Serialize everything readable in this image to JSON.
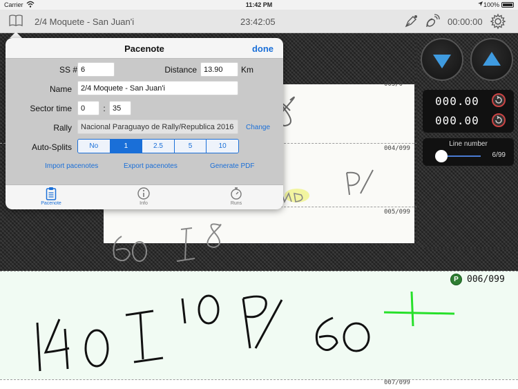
{
  "status_bar": {
    "carrier": "Carrier",
    "time": "11:42 PM",
    "battery": "100%"
  },
  "nav_bar": {
    "title": "2/4 Moquete - San Juan'i",
    "clock": "23:42:05",
    "timer": "00:00:00"
  },
  "pacenote": {
    "title": "Pacenote",
    "done_label": "done",
    "ss_label": "SS #",
    "ss_value": "6",
    "distance_label": "Distance",
    "distance_value": "13.90",
    "distance_unit": "Km",
    "name_label": "Name",
    "name_value": "2/4 Moquete - San Juan'i",
    "sector_label": "Sector time",
    "sector_min": "0",
    "sector_sep": ":",
    "sector_sec": "35",
    "rally_label": "Rally",
    "rally_value": "Nacional Paraguayo de Rally/Republica 2016",
    "change_label": "Change",
    "autosplits_label": "Auto-Splits",
    "autosplits_options": [
      "No",
      "1",
      "2.5",
      "5",
      "10"
    ],
    "autosplits_selected": "1",
    "import_label": "Import pacenotes",
    "export_label": "Export pacenotes",
    "pdf_label": "Generate PDF",
    "tabs": [
      {
        "label": "Pacenote"
      },
      {
        "label": "Info"
      },
      {
        "label": "Runs"
      }
    ]
  },
  "odometer": {
    "value1": "000.00",
    "value2": "000.00"
  },
  "line_number": {
    "label": "Line number",
    "value": "6/99",
    "position": 0.06
  },
  "lines": {
    "l3": "003/0",
    "l4": "004/099",
    "l5": "005/099",
    "l6": "006/099",
    "l7": "007/099"
  },
  "colors": {
    "accent": "#1a6fd8",
    "ink": "#111111",
    "green_mark": "#27e02a",
    "highlight": "#e9ef4a"
  }
}
